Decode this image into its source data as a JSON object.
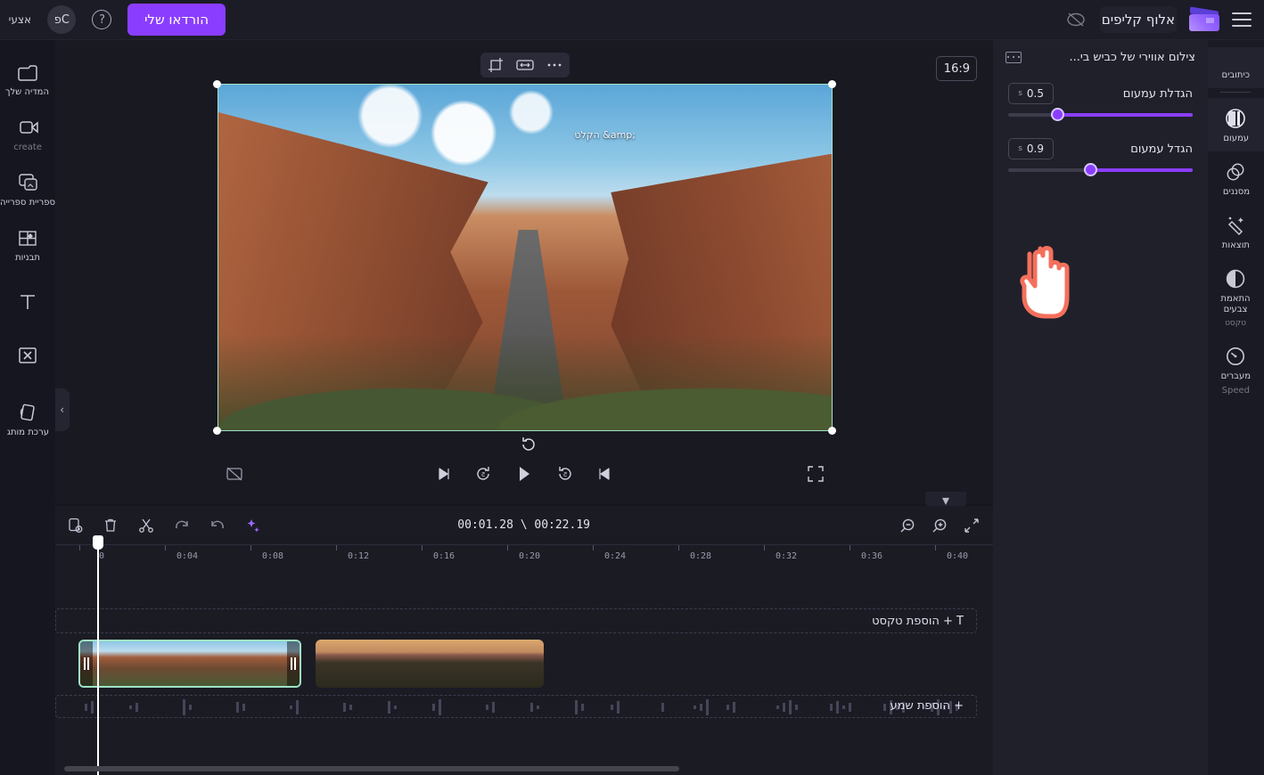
{
  "app": {
    "title": "אלוף קליפים",
    "export_label": "הורדאו שלי",
    "account_initials": "פC",
    "help_label": "?",
    "corner_label": "אצעי",
    "logo_name": "clapperboard-logo"
  },
  "left_rail": {
    "items": [
      {
        "id": "captions",
        "label": "כיתובים",
        "icon": "captions-icon",
        "active": true
      },
      {
        "id": "fade",
        "label": "עמעום",
        "icon": "fade-icon",
        "active": true
      },
      {
        "id": "filters",
        "label": "מסננים",
        "icon": "filters-icon",
        "active": false
      },
      {
        "id": "effects",
        "label": "תוצאות",
        "icon": "effects-icon",
        "active": false
      },
      {
        "id": "color",
        "label": "התאמת צבעים",
        "label2": "טקסט",
        "icon": "color-adjust-icon",
        "active": false
      },
      {
        "id": "speed",
        "label": "מעברים",
        "label2": "Speed",
        "icon": "speed-icon",
        "active": false
      }
    ]
  },
  "panel": {
    "title": "צילום אווירי של כביש בי...",
    "filmstrip_icon": "filmstrip-icon",
    "controls": [
      {
        "id": "fade-in",
        "label": "הגדלת עמעום",
        "value": "0.5",
        "unit": "s",
        "percent": 73
      },
      {
        "id": "fade-out",
        "label": "הגדל עמעום",
        "value": "0.9",
        "unit": "s",
        "percent": 55
      }
    ],
    "cursor_icon": "pointing-hand-cursor"
  },
  "stage": {
    "aspect_ratio": "16:9",
    "float_tools": [
      {
        "id": "more",
        "icon": "more-horizontal-icon",
        "glyph": "⋯"
      },
      {
        "id": "resize",
        "icon": "resize-horizontal-icon",
        "glyph": "↔"
      },
      {
        "id": "crop",
        "icon": "crop-icon",
        "glyph": "⌧"
      }
    ],
    "video_caption": "הקלט &amp;",
    "rotate_icon": "rotate-handle-icon",
    "playback": [
      {
        "id": "fullscreen",
        "icon": "fullscreen-icon"
      },
      {
        "id": "skip-start",
        "icon": "skip-to-start-icon"
      },
      {
        "id": "back-5",
        "icon": "rewind-5s-icon"
      },
      {
        "id": "play",
        "icon": "play-icon"
      },
      {
        "id": "forward-5",
        "icon": "forward-5s-icon"
      },
      {
        "id": "skip-end",
        "icon": "skip-to-end-icon"
      },
      {
        "id": "mute",
        "icon": "mute-crossed-icon"
      }
    ]
  },
  "timeline": {
    "current_time": "00:01.28",
    "total_time": "00:22.19",
    "time_display": "00:01.28 \\ 00:22.19",
    "left_tools": [
      {
        "id": "fit",
        "icon": "fit-to-screen-icon"
      },
      {
        "id": "zoom-in",
        "icon": "zoom-in-icon"
      },
      {
        "id": "zoom-out",
        "icon": "zoom-out-icon"
      }
    ],
    "right_tools": [
      {
        "id": "duplicate",
        "icon": "duplicate-icon"
      },
      {
        "id": "delete",
        "icon": "trash-icon"
      },
      {
        "id": "split",
        "icon": "scissors-split-icon"
      },
      {
        "id": "undo",
        "icon": "undo-icon"
      },
      {
        "id": "redo",
        "icon": "redo-icon"
      },
      {
        "id": "magic",
        "icon": "ai-sparkle-icon"
      }
    ],
    "ruler_labels": [
      "0",
      "0:04",
      "0:08",
      "0:12",
      "0:16",
      "0:20",
      "0:24",
      "0:28",
      "0:32",
      "0:36",
      "0:40"
    ],
    "text_track_label": "הוספת טקסט + T",
    "text_track_icon": "text-T-icon",
    "audio_track_label": "הוספת שמע +",
    "audio_track_icon": "music-note-icon",
    "clips": [
      {
        "id": "clip-1",
        "selected": false,
        "thumb_style": "tA"
      },
      {
        "id": "clip-2",
        "selected": true,
        "thumb_style": "tB"
      }
    ]
  },
  "right_rail": {
    "items": [
      {
        "id": "media",
        "label": "המדיה שלך",
        "icon": "folder-media-icon"
      },
      {
        "id": "create",
        "label": "create",
        "icon": "video-camera-icon"
      },
      {
        "id": "library",
        "label": "ספריית ספרייה",
        "icon": "stock-library-icon"
      },
      {
        "id": "templates",
        "label": "תבניות",
        "icon": "templates-grid-icon"
      },
      {
        "id": "text",
        "label": "",
        "icon": "text-T-icon"
      },
      {
        "id": "transition",
        "label": "",
        "icon": "transition-x-icon"
      },
      {
        "id": "brand",
        "label": "ערכת מותג",
        "icon": "brand-kit-icon"
      }
    ]
  },
  "colors": {
    "accent": "#8b3dff",
    "selection": "#9fe3c6",
    "panel_bg": "#20202b",
    "app_bg": "#16161f"
  }
}
